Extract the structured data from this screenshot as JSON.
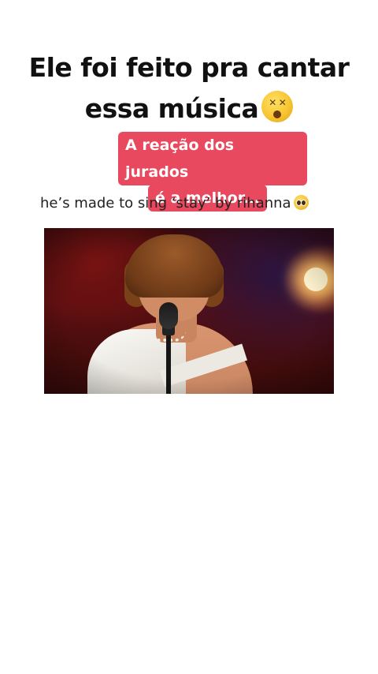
{
  "overlay": {
    "headline_line1": "Ele foi feito pra cantar",
    "headline_line2": "essa música",
    "headline_emoji": "dizzy-face-icon",
    "pill_line1": "A reação dos jurados",
    "pill_line2": "é a melhor...",
    "pill_color": "#e8495e"
  },
  "post": {
    "caption": "he’s made to sing ‘stay’ by rihanna",
    "caption_emoji": "pleading-face-icon"
  },
  "video": {
    "scene": "singer-at-microphone"
  }
}
